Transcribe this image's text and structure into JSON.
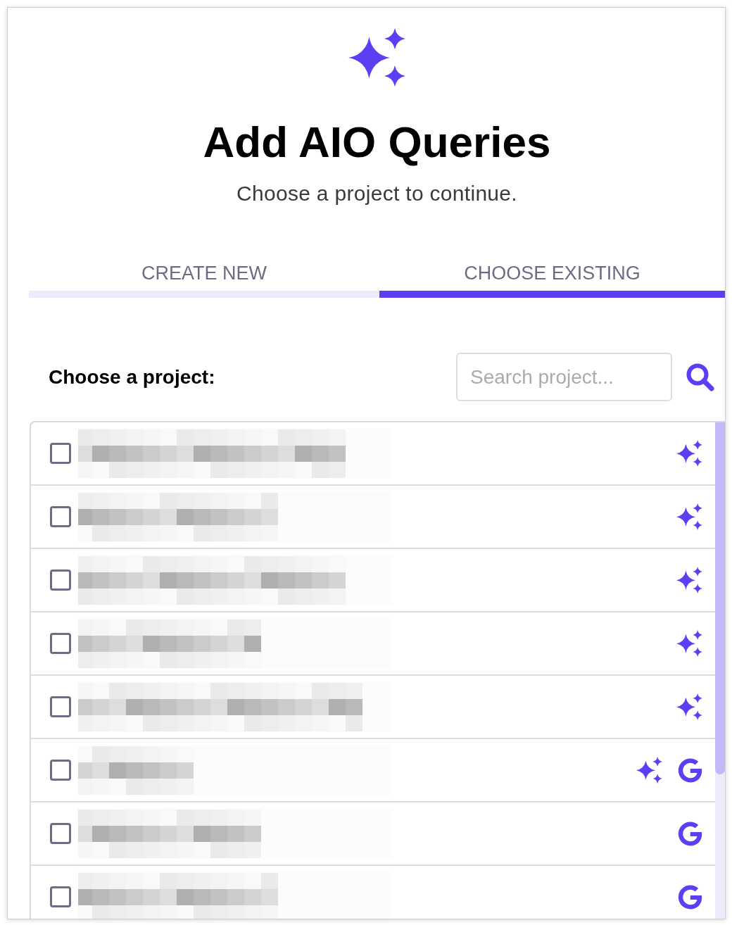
{
  "header": {
    "title": "Add AIO Queries",
    "subtitle": "Choose a project to continue."
  },
  "tabs": [
    {
      "label": "CREATE NEW",
      "selected": false
    },
    {
      "label": "CHOOSE EXISTING",
      "selected": true
    }
  ],
  "project_picker": {
    "label": "Choose a project:",
    "search": {
      "placeholder": "Search project..."
    }
  },
  "projects": [
    {
      "checked": false,
      "badges": [
        {
          "kind": "ai"
        }
      ]
    },
    {
      "checked": false,
      "badges": [
        {
          "kind": "ai"
        }
      ]
    },
    {
      "checked": false,
      "badges": [
        {
          "kind": "ai"
        }
      ]
    },
    {
      "checked": false,
      "badges": [
        {
          "kind": "ai"
        }
      ]
    },
    {
      "checked": false,
      "badges": [
        {
          "kind": "ai"
        }
      ]
    },
    {
      "checked": false,
      "badges": [
        {
          "kind": "ai"
        },
        {
          "kind": "google"
        }
      ]
    },
    {
      "checked": false,
      "badges": [
        {
          "kind": "google"
        }
      ]
    },
    {
      "checked": false,
      "badges": [
        {
          "kind": "google"
        }
      ]
    }
  ]
}
